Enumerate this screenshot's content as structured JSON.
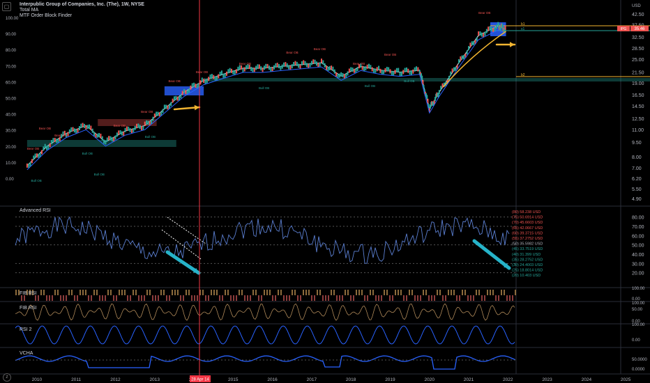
{
  "header": {
    "title": "Interpublic Group of Companies, Inc. (The), 1W, NYSE",
    "indicator1": "Total MA",
    "indicator2": "MTF Order Block Finder"
  },
  "colors": {
    "background": "#000000",
    "accent_blue": "#2962ff",
    "bull": "#26a69a",
    "bear": "#ef5350",
    "annotation_arrow": "#f2b531",
    "teal_arrow": "#26b3c9",
    "cursor_line": "#f23645"
  },
  "chart_data": [
    {
      "type": "line",
      "name": "price",
      "title": "Interpublic Group of Companies, Inc. (The), 1W, NYSE",
      "x": [
        2010,
        2010.5,
        2011,
        2011.5,
        2012,
        2012.5,
        2013,
        2013.5,
        2014,
        2014.5,
        2015,
        2015.5,
        2016,
        2016.5,
        2017,
        2017.5,
        2018,
        2018.5,
        2019,
        2019.5,
        2020,
        2020.25,
        2020.5,
        2021,
        2021.5,
        2022,
        2022.2
      ],
      "y": [
        7.2,
        9.0,
        10.5,
        11.5,
        9.5,
        10.8,
        11.5,
        14.0,
        17.0,
        19.5,
        21.0,
        22.5,
        22.5,
        23.0,
        23.5,
        24.0,
        20.5,
        23.0,
        22.0,
        21.5,
        22.0,
        14.0,
        17.0,
        24.0,
        33.0,
        37.0,
        35.5
      ],
      "x_ticks": [
        "2010",
        "2011",
        "2012",
        "2013",
        "2014",
        "2015",
        "2016",
        "2017",
        "2018",
        "2019",
        "2020",
        "2021",
        "2022",
        "2023",
        "2024",
        "2025"
      ],
      "y_ticks_right": [
        "42.50",
        "37.50",
        "32.50",
        "28.50",
        "25.00",
        "21.50",
        "19.00",
        "16.50",
        "14.50",
        "12.50",
        "11.00",
        "9.50",
        "8.00",
        "7.00",
        "6.20",
        "5.50",
        "4.90"
      ],
      "y_ticks_left": [
        "100.00",
        "90.00",
        "80.00",
        "70.00",
        "60.00",
        "50.00",
        "40.00",
        "30.00",
        "20.00",
        "10.00",
        "0.00"
      ],
      "last_price": "35.46",
      "ticker_badge": "IPG",
      "y_unit": "USD",
      "annotations": [
        "Bear OB",
        "Bull OB"
      ]
    },
    {
      "type": "line",
      "name": "Advanced RSI",
      "title": "Advanced RSI",
      "ylim": [
        10,
        85
      ],
      "y_ticks_right": [
        "80.00",
        "70.00",
        "60.00",
        "50.00",
        "40.00",
        "30.00",
        "20.00"
      ],
      "levels": [
        {
          "label": "(80)",
          "value": "58.238 USD"
        },
        {
          "label": "(75)",
          "value": "50.6914 USD"
        },
        {
          "label": "(70)",
          "value": "45.6603 USD"
        },
        {
          "label": "(65)",
          "value": "42.0667 USD"
        },
        {
          "label": "(60)",
          "value": "39.3715 USD"
        },
        {
          "label": "(55)",
          "value": "37.2752 USD"
        },
        {
          "label": "(50)",
          "value": "35.5982 USD"
        },
        {
          "label": "(45)",
          "value": "33.7519 USD"
        },
        {
          "label": "(40)",
          "value": "31.399 USD"
        },
        {
          "label": "(35)",
          "value": "28.2752 USD"
        },
        {
          "label": "(30)",
          "value": "24.4003 USD"
        },
        {
          "label": "(25)",
          "value": "18.8014 USD"
        },
        {
          "label": "(20)",
          "value": "10.403 USD"
        }
      ]
    },
    {
      "type": "line",
      "name": "FIB RSI 1",
      "title": "FIB RSI",
      "y_ticks_right": [
        "100.00",
        "0.00"
      ]
    },
    {
      "type": "line",
      "name": "FIB RSI 2",
      "title": "FIB RSI",
      "y_ticks_right": [
        "100.00",
        "50.00",
        "0.00"
      ]
    },
    {
      "type": "line",
      "name": "RSI 2",
      "title": "RSI 2",
      "y_ticks_right": [
        "100.00",
        "0.00"
      ]
    },
    {
      "type": "line",
      "name": "VCHA",
      "title": "VCHA",
      "y_ticks_right": [
        "50.0000",
        "0.0000"
      ]
    }
  ],
  "cursor": {
    "date_label": "28 Apr 14"
  },
  "price_tags": [
    "b1",
    "s1",
    "b2"
  ]
}
